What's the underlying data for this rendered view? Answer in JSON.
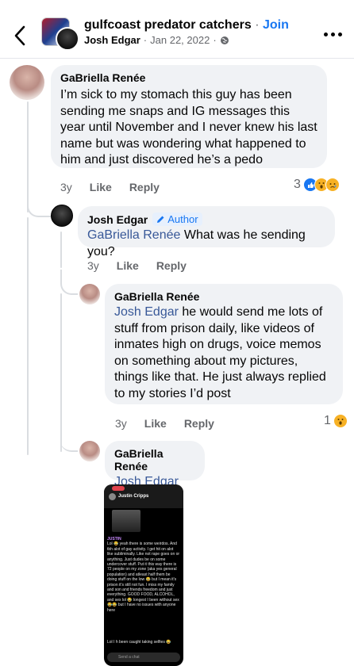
{
  "header": {
    "group_name": "gulfcoast predator catchers",
    "separator": "·",
    "join_label": "Join",
    "post_author": "Josh Edgar",
    "post_date": "Jan 22, 2022",
    "privacy_icon": "globe-icon"
  },
  "comments": [
    {
      "author": "GaBriella Renée",
      "text": "I’m sick to my stomach this guy has been sending me snaps and IG messages this year until November and I never knew his last name but was wondering what happened to him and just discovered he’s a pedo",
      "time": "3y",
      "like_label": "Like",
      "reply_label": "Reply",
      "reaction_count": "3",
      "reactions": [
        "like",
        "wow",
        "sad"
      ]
    },
    {
      "author": "Josh Edgar",
      "badge": "Author",
      "mention": "GaBriella Renée",
      "text": " What was he sending you?",
      "time": "3y",
      "like_label": "Like",
      "reply_label": "Reply"
    },
    {
      "author": "GaBriella Renée",
      "mention": "Josh Edgar",
      "text": " he would send me lots of stuff from prison daily, like videos of inmates high on drugs, voice memos on something about my pictures, things like that. He just always replied to my stories I’d post",
      "time": "3y",
      "like_label": "Like",
      "reply_label": "Reply",
      "reaction_count": "1",
      "reactions": [
        "wow"
      ]
    },
    {
      "author": "GaBriella Renée",
      "mention": "Josh Edgar"
    }
  ],
  "attachment": {
    "contact_name": "Justin Cripps",
    "chat_label": "JUSTIN",
    "chat_text": "Lol 😂 yeah there is some weirdos. And tbh alot of gay activity. I get hit on alot like subliminally. Like not rape goes on or anything. Just dudes be on some undercover stuff. Put it this way there is 72 people on my zone (aka yes general population) and atleast half them be doing stuff on the low 😂 but I mean it's prison it's still not fun. I miss my family and son and friends freedom and just everything. GOOD FOOD, ALCOHOL, and sex lol 😂 longest I been without sex 😂😂 but I have no issues with anyone here",
    "sent_text": "Lol I h been caught taking selfies 😂",
    "input_placeholder": "Send a chat"
  }
}
